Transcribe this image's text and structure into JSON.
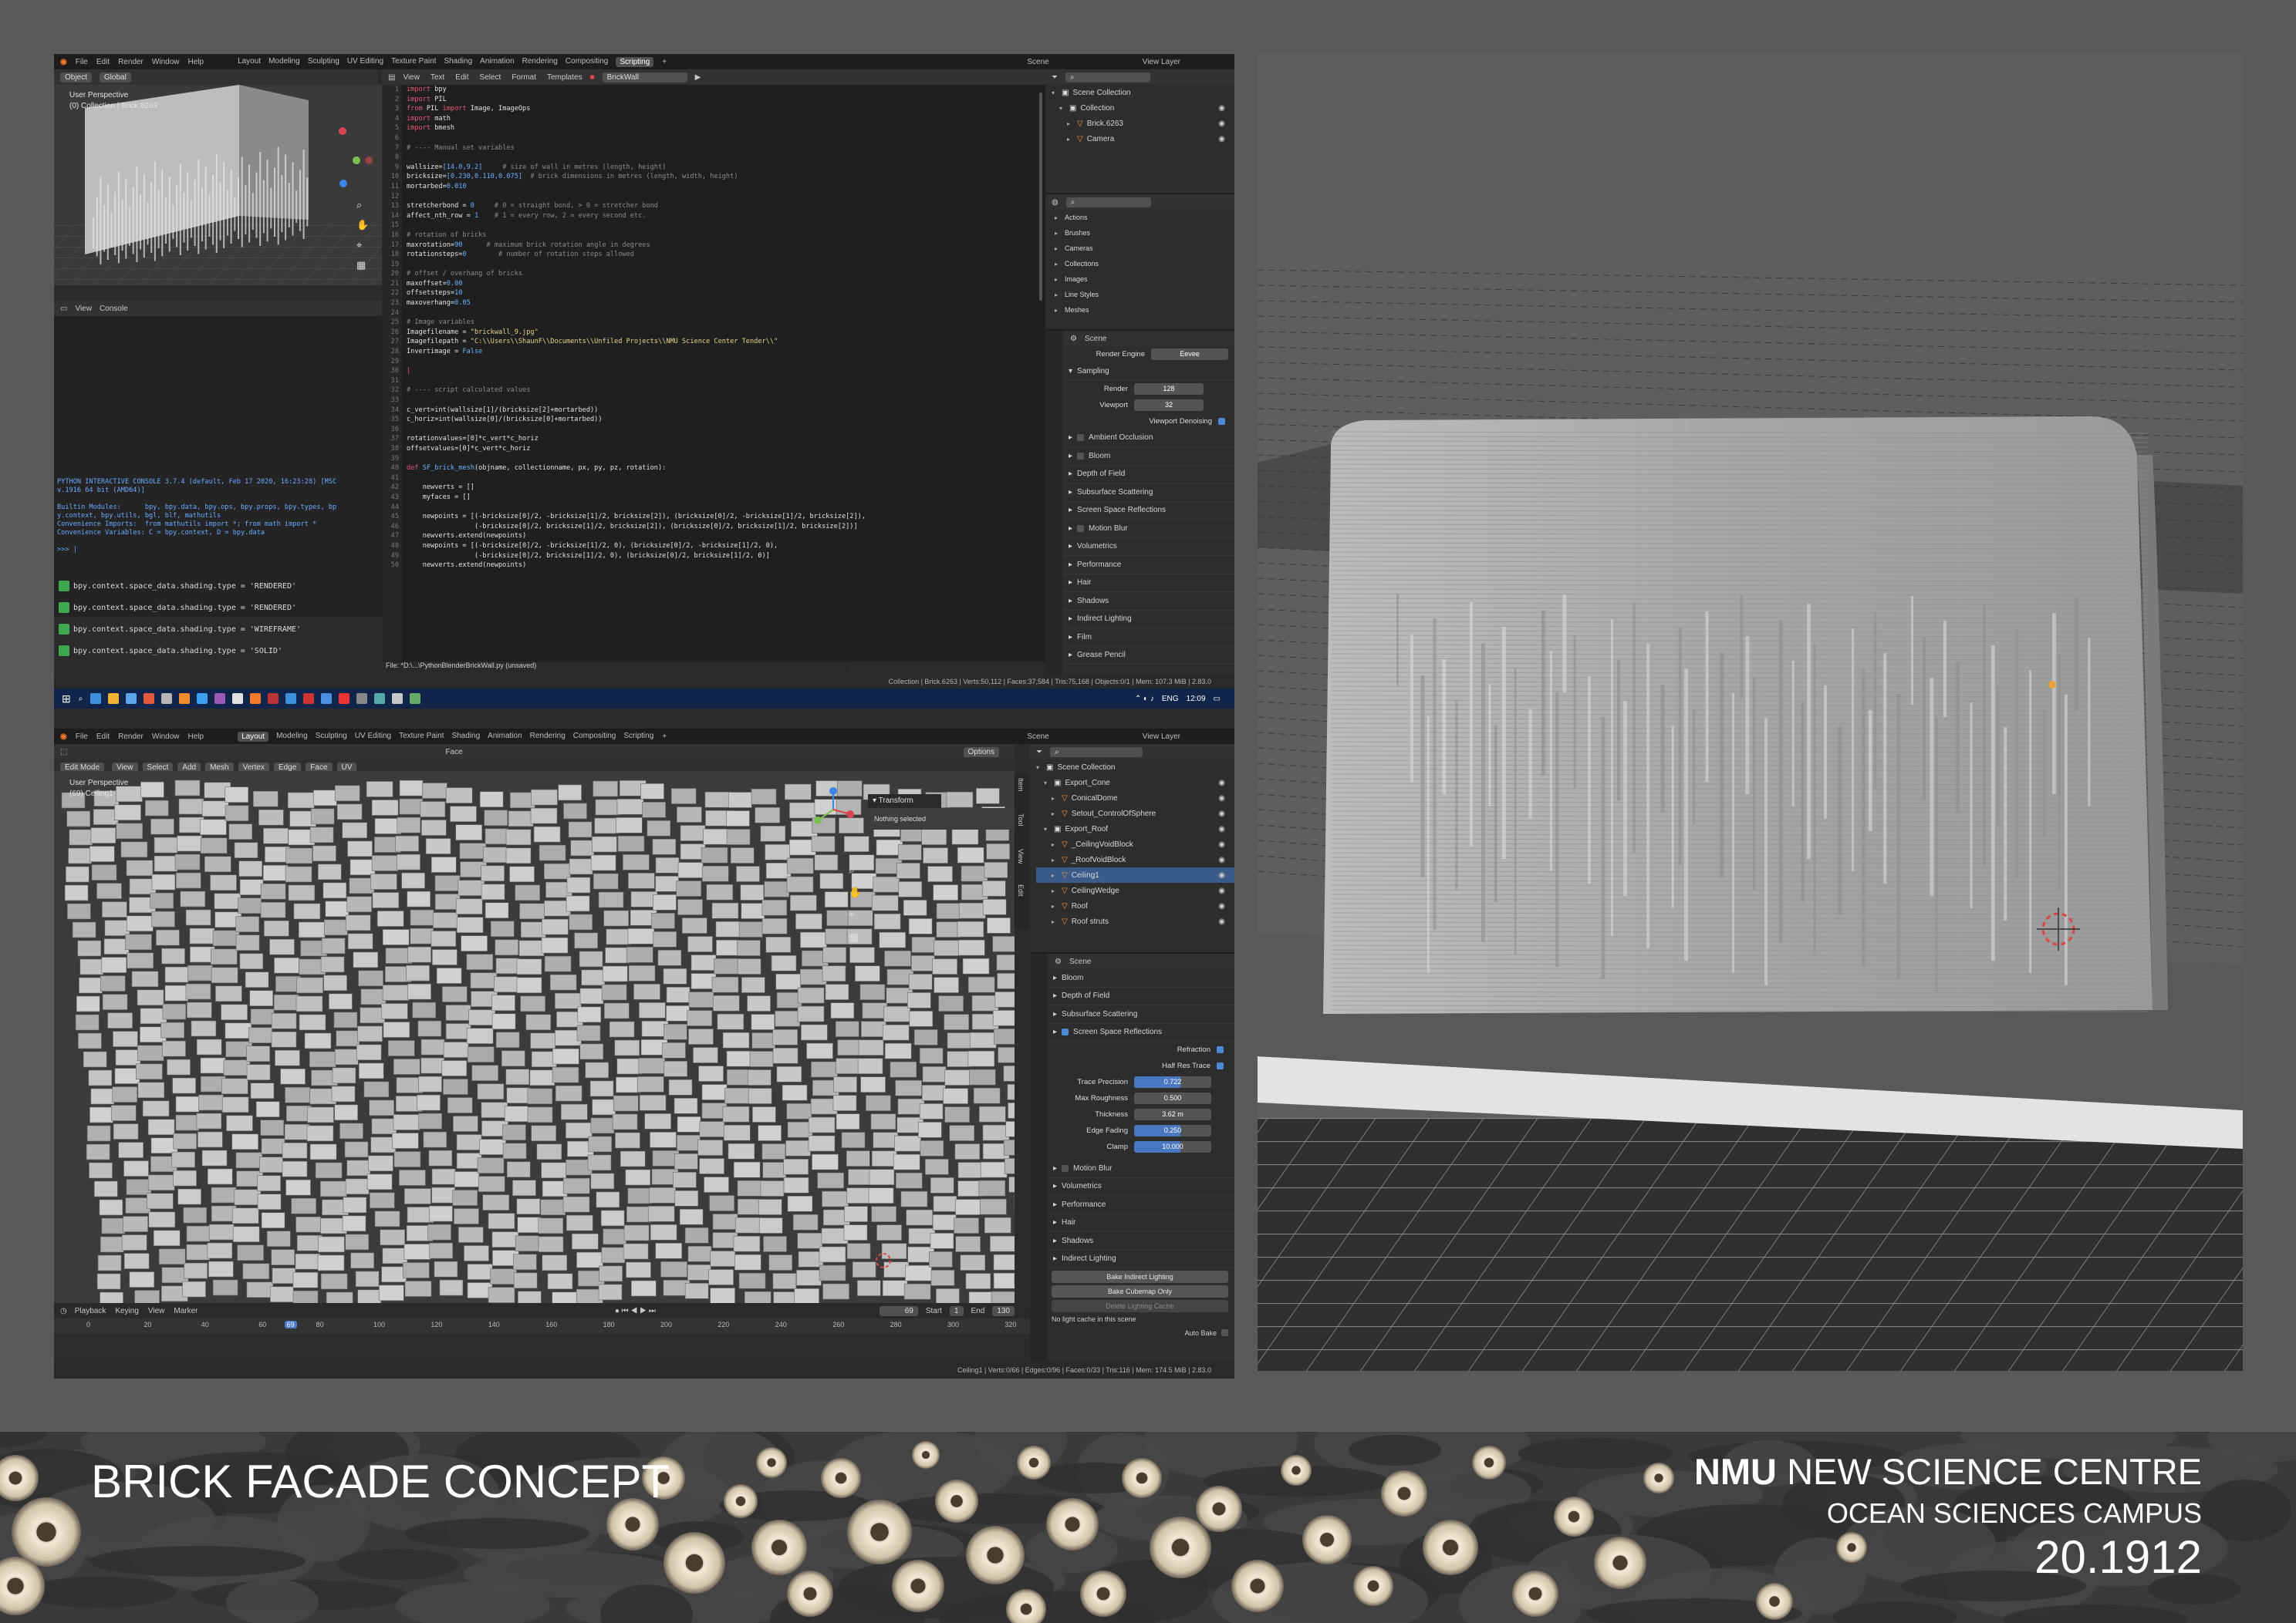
{
  "presentation": {
    "concept_title": "BRICK FACADE CONCEPT",
    "project_bold": "NMU",
    "project_rest": "NEW SCIENCE CENTRE",
    "campus": "OCEAN SCIENCES CAMPUS",
    "project_number": "20.1912"
  },
  "shot1": {
    "menu": [
      "File",
      "Edit",
      "Render",
      "Window",
      "Help"
    ],
    "workspaces": [
      "Layout",
      "Modeling",
      "Sculpting",
      "UV Editing",
      "Texture Paint",
      "Shading",
      "Animation",
      "Rendering",
      "Compositing",
      "Scripting"
    ],
    "active_workspace": "Scripting",
    "scene": "Scene",
    "view_layer": "View Layer",
    "viewport_header": [
      "Object",
      "Global"
    ],
    "viewport_label": "User Perspective",
    "viewport_sublabel": "(0) Collection | Brick.6263",
    "editor_header": [
      "View",
      "Text",
      "Edit",
      "Select",
      "Format",
      "Templates"
    ],
    "text_name": "BrickWall",
    "console_header": [
      "View",
      "Console"
    ],
    "console_intro": [
      "PYTHON INTERACTIVE CONSOLE 3.7.4 (default, Feb 17 2020, 16:23:28) [MSC",
      "v.1916 64 bit (AMD64)]",
      "",
      "Builtin Modules:      bpy, bpy.data, bpy.ops, bpy.props, bpy.types, bp",
      "y.context, bpy.utils, bgl, blf, mathutils",
      "Convenience Imports:  from mathutils import *; from math import *",
      "Convenience Variables: C = bpy.context, D = bpy.data",
      "",
      ">>> |"
    ],
    "history": [
      "bpy.context.space_data.shading.type = 'RENDERED'",
      "bpy.context.space_data.shading.type = 'RENDERED'",
      "bpy.context.space_data.shading.type = 'WIREFRAME'",
      "bpy.context.space_data.shading.type = 'SOLID'"
    ],
    "file_status": "File: *D:\\...\\PythonBlenderBrickWall.py (unsaved)",
    "status": "Collection | Brick.6263 | Verts:50,112 | Faces:37,584 | Tris:75,168 | Objects:0/1 | Mem: 107.3 MiB | 2.83.0",
    "outliner": [
      {
        "label": "Scene Collection",
        "indent": 0
      },
      {
        "label": "Collection",
        "indent": 1
      },
      {
        "label": "Brick.6263",
        "indent": 2
      },
      {
        "label": "Camera",
        "indent": 2
      }
    ],
    "datablocks": [
      "Actions",
      "Brushes",
      "Cameras",
      "Collections",
      "Images",
      "Line Styles",
      "Meshes"
    ],
    "props_context": "Scene",
    "render_engine_label": "Render Engine",
    "render_engine": "Eevee",
    "sampling": "Sampling",
    "render_label": "Render",
    "render_samples": "128",
    "viewport_label2": "Viewport",
    "viewport_samples": "32",
    "viewport_denoise": "Viewport Denoising",
    "panels": [
      "Ambient Occlusion",
      "Bloom",
      "Depth of Field",
      "Subsurface Scattering",
      "Screen Space Reflections",
      "Motion Blur",
      "Volumetrics",
      "Performance",
      "Hair",
      "Shadows",
      "Indirect Lighting",
      "Film",
      "Grease Pencil"
    ],
    "taskbar_lang": "ENG",
    "taskbar_time": "12:09"
  },
  "code_lines": [
    [
      [
        "kw",
        "import"
      ],
      [
        "tx",
        " bpy"
      ]
    ],
    [
      [
        "kw",
        "import"
      ],
      [
        "tx",
        " PIL"
      ]
    ],
    [
      [
        "kw",
        "from"
      ],
      [
        "tx",
        " PIL "
      ],
      [
        "kw",
        "import"
      ],
      [
        "tx",
        " Image, ImageOps"
      ]
    ],
    [
      [
        "kw",
        "import"
      ],
      [
        "tx",
        " math"
      ]
    ],
    [
      [
        "kw",
        "import"
      ],
      [
        "tx",
        " bmesh"
      ]
    ],
    [
      [
        "tx",
        ""
      ]
    ],
    [
      [
        "cm",
        "# ---- Manual set variables"
      ]
    ],
    [
      [
        "tx",
        ""
      ]
    ],
    [
      [
        "tx",
        "wallsize="
      ],
      [
        "nm",
        "[14.0,9.2]"
      ],
      [
        "cm",
        "     # size of wall in metres (length, height)"
      ]
    ],
    [
      [
        "tx",
        "bricksize="
      ],
      [
        "nm",
        "[0.230,0.110,0.075]"
      ],
      [
        "cm",
        "  # brick dimensions in metres (length, width, height)"
      ]
    ],
    [
      [
        "tx",
        "mortarbed="
      ],
      [
        "nm",
        "0.010"
      ]
    ],
    [
      [
        "tx",
        ""
      ]
    ],
    [
      [
        "tx",
        "stretcherbond = "
      ],
      [
        "nm",
        "0"
      ],
      [
        "cm",
        "     # 0 = straight bond, > 0 = stretcher bond"
      ]
    ],
    [
      [
        "tx",
        "affect_nth_row = "
      ],
      [
        "nm",
        "1"
      ],
      [
        "cm",
        "    # 1 = every row, 2 = every second etc."
      ]
    ],
    [
      [
        "tx",
        ""
      ]
    ],
    [
      [
        "cm",
        "# rotation of bricks"
      ]
    ],
    [
      [
        "tx",
        "maxrotation="
      ],
      [
        "nm",
        "90"
      ],
      [
        "cm",
        "      # maximum brick rotation angle in degrees"
      ]
    ],
    [
      [
        "tx",
        "rotationsteps="
      ],
      [
        "nm",
        "0"
      ],
      [
        "cm",
        "        # number of rotation steps allowed"
      ]
    ],
    [
      [
        "tx",
        ""
      ]
    ],
    [
      [
        "cm",
        "# offset / overhang of bricks"
      ]
    ],
    [
      [
        "tx",
        "maxoffset="
      ],
      [
        "nm",
        "0.00"
      ]
    ],
    [
      [
        "tx",
        "offsetsteps="
      ],
      [
        "nm",
        "10"
      ]
    ],
    [
      [
        "tx",
        "maxoverhang="
      ],
      [
        "nm",
        "0.05"
      ]
    ],
    [
      [
        "tx",
        ""
      ]
    ],
    [
      [
        "cm",
        "# Image variables"
      ]
    ],
    [
      [
        "tx",
        "Imagefilename = "
      ],
      [
        "st",
        "\"brickwall_9.jpg\""
      ]
    ],
    [
      [
        "tx",
        "Imagefilepath = "
      ],
      [
        "st",
        "\"C:\\\\Users\\\\ShaunF\\\\Documents\\\\Unfiled Projects\\\\NMU Science Center Tender\\\\\""
      ]
    ],
    [
      [
        "tx",
        "Invertimage = "
      ],
      [
        "nm",
        "False"
      ]
    ],
    [
      [
        "tx",
        ""
      ]
    ],
    [
      [
        "kw",
        "|"
      ]
    ],
    [
      [
        "tx",
        ""
      ]
    ],
    [
      [
        "cm",
        "# ---- script calculated values"
      ]
    ],
    [
      [
        "tx",
        ""
      ]
    ],
    [
      [
        "tx",
        "c_vert=int(wallsize[1]/(bricksize[2]+mortarbed))"
      ]
    ],
    [
      [
        "tx",
        "c_horiz=int(wallsize[0]/(bricksize[0]+mortarbed))"
      ]
    ],
    [
      [
        "tx",
        ""
      ]
    ],
    [
      [
        "tx",
        "rotationvalues=[0]*c_vert*c_horiz"
      ]
    ],
    [
      [
        "tx",
        "offsetvalues=[0]*c_vert*c_horiz"
      ]
    ],
    [
      [
        "tx",
        ""
      ]
    ],
    [
      [
        "kw",
        "def"
      ],
      [
        "nm",
        " SF_brick_mesh"
      ],
      [
        "tx",
        "(objname, collectionname, px, py, pz, rotation):"
      ]
    ],
    [
      [
        "tx",
        ""
      ]
    ],
    [
      [
        "tx",
        "    newverts = []"
      ]
    ],
    [
      [
        "tx",
        "    myfaces = []"
      ]
    ],
    [
      [
        "tx",
        ""
      ]
    ],
    [
      [
        "tx",
        "    newpoints = [(-bricksize[0]/2, -bricksize[1]/2, bricksize[2]), (bricksize[0]/2, -bricksize[1]/2, bricksize[2]),"
      ]
    ],
    [
      [
        "tx",
        "                 (-bricksize[0]/2, bricksize[1]/2, bricksize[2]), (bricksize[0]/2, bricksize[1]/2, bricksize[2])]"
      ]
    ],
    [
      [
        "tx",
        "    newverts.extend(newpoints)"
      ]
    ],
    [
      [
        "tx",
        "    newpoints = [(-bricksize[0]/2, -bricksize[1]/2, 0), (bricksize[0]/2, -bricksize[1]/2, 0),"
      ]
    ],
    [
      [
        "tx",
        "                 (-bricksize[0]/2, bricksize[1]/2, 0), (bricksize[0]/2, bricksize[1]/2, 0)]"
      ]
    ],
    [
      [
        "tx",
        "    newverts.extend(newpoints)"
      ]
    ]
  ],
  "shot2": {
    "menu": [
      "File",
      "Edit",
      "Render",
      "Window",
      "Help"
    ],
    "workspaces": [
      "Layout",
      "Modeling",
      "Sculpting",
      "UV Editing",
      "Texture Paint",
      "Shading",
      "Animation",
      "Rendering",
      "Compositing",
      "Scripting"
    ],
    "active_workspace": "Layout",
    "scene": "Scene",
    "view_layer": "View Layer",
    "mode": "Edit Mode",
    "header_menus": [
      "View",
      "Select",
      "Add",
      "Mesh",
      "Vertex",
      "Edge",
      "Face",
      "UV"
    ],
    "face_label": "Face",
    "options": "Options",
    "viewport_label": "User Perspective",
    "viewport_sublabel": "(69) Ceiling1",
    "transform_title": "Transform",
    "transform_msg": "Nothing selected",
    "side_tabs": [
      "Item",
      "Tool",
      "View",
      "Edit"
    ],
    "timeline_menus": [
      "Playback",
      "Keying",
      "View",
      "Marker"
    ],
    "current_frame": "69",
    "start_label": "Start",
    "start_value": "1",
    "end_label": "End",
    "end_value": "130",
    "ruler": [
      "0",
      "20",
      "40",
      "60",
      "69",
      "80",
      "100",
      "120",
      "140",
      "160",
      "180",
      "200",
      "220",
      "240",
      "260",
      "280",
      "300",
      "320"
    ],
    "status": "Ceiling1 | Verts:0/66 | Edges:0/96 | Faces:0/33 | Tris:116 | Mem: 174.5 MiB | 2.83.0",
    "outliner": [
      {
        "label": "Scene Collection",
        "indent": 0,
        "sel": false
      },
      {
        "label": "Export_Cone",
        "indent": 1,
        "sel": false
      },
      {
        "label": "ConicalDome",
        "indent": 2,
        "sel": false
      },
      {
        "label": "Setout_ControlOfSphere",
        "indent": 2,
        "sel": false
      },
      {
        "label": "Export_Roof",
        "indent": 1,
        "sel": false
      },
      {
        "label": "_CeilingVoidBlock",
        "indent": 2,
        "sel": false
      },
      {
        "label": "_RoofVoidBlock",
        "indent": 2,
        "sel": false
      },
      {
        "label": "Ceiling1",
        "indent": 2,
        "sel": true
      },
      {
        "label": "CeilingWedge",
        "indent": 2,
        "sel": false
      },
      {
        "label": "Roof",
        "indent": 2,
        "sel": false
      },
      {
        "label": "Roof struts",
        "indent": 2,
        "sel": false
      }
    ],
    "props_context": "Scene",
    "panels_top": [
      "Bloom",
      "Depth of Field",
      "Subsurface Scattering",
      "Screen Space Reflections"
    ],
    "ssr_fields": [
      {
        "label": "Trace Precision",
        "value": "0.722"
      },
      {
        "label": "Max Roughness",
        "value": "0.500"
      },
      {
        "label": "Thickness",
        "value": "3.62 m"
      },
      {
        "label": "Edge Fading",
        "value": "0.250"
      },
      {
        "label": "Clamp",
        "value": "10.000"
      }
    ],
    "refraction": "Refraction",
    "half_res": "Half Res Trace",
    "panels_bottom": [
      "Motion Blur",
      "Volumetrics",
      "Performance",
      "Hair",
      "Shadows",
      "Indirect Lighting"
    ],
    "bake_indirect": "Bake Indirect Lighting",
    "bake_cubemap": "Bake Cubemap Only",
    "delete_cache": "Delete Lighting Cache",
    "no_cache": "No light cache in this scene",
    "auto_bake": "Auto Bake"
  }
}
